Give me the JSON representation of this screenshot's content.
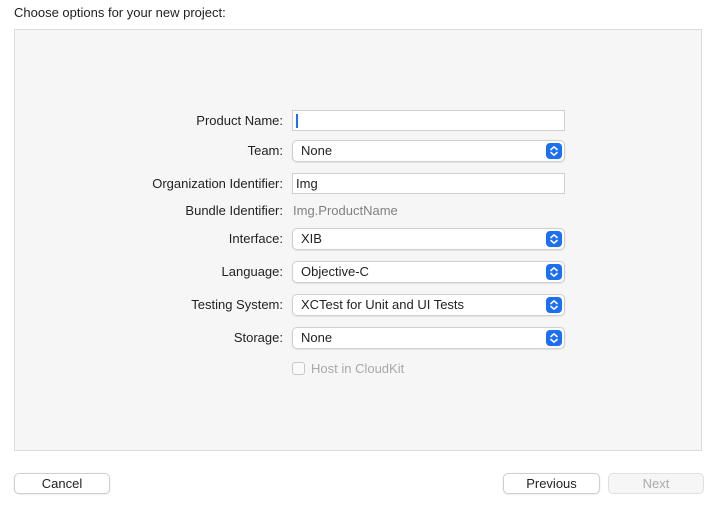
{
  "heading": "Choose options for your new project:",
  "form": {
    "product_name": {
      "label": "Product Name:",
      "value": ""
    },
    "team": {
      "label": "Team:",
      "value": "None"
    },
    "organization_identifier": {
      "label": "Organization Identifier:",
      "value": "Img"
    },
    "bundle_identifier": {
      "label": "Bundle Identifier:",
      "value": "Img.ProductName"
    },
    "interface": {
      "label": "Interface:",
      "value": "XIB"
    },
    "language": {
      "label": "Language:",
      "value": "Objective-C"
    },
    "testing_system": {
      "label": "Testing System:",
      "value": "XCTest for Unit and UI Tests"
    },
    "storage": {
      "label": "Storage:",
      "value": "None"
    },
    "host_in_cloudkit": {
      "label": "Host in CloudKit",
      "checked": false,
      "enabled": false
    }
  },
  "buttons": {
    "cancel": "Cancel",
    "previous": "Previous",
    "next": "Next"
  },
  "colors": {
    "accent": "#1d6ff2",
    "panel_bg": "#f6f6f6"
  }
}
